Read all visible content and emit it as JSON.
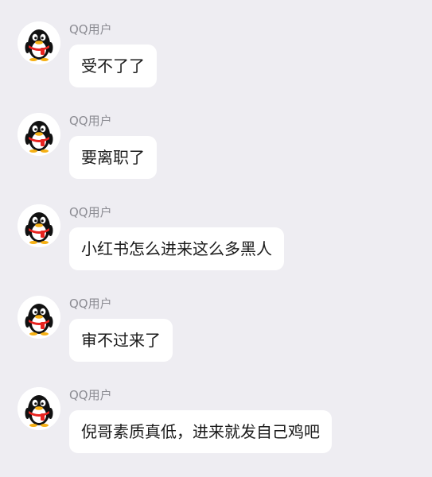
{
  "chat": {
    "messages": [
      {
        "sender": "QQ用户",
        "avatar_icon": "qq-penguin-icon",
        "text": "受不了了"
      },
      {
        "sender": "QQ用户",
        "avatar_icon": "qq-penguin-icon",
        "text": "要离职了"
      },
      {
        "sender": "QQ用户",
        "avatar_icon": "qq-penguin-icon",
        "text": "小红书怎么进来这么多黑人"
      },
      {
        "sender": "QQ用户",
        "avatar_icon": "qq-penguin-icon",
        "text": "审不过来了"
      },
      {
        "sender": "QQ用户",
        "avatar_icon": "qq-penguin-icon",
        "text": "倪哥素质真低，进来就发自己鸡吧"
      }
    ]
  },
  "colors": {
    "background": "#eeedf2",
    "bubble": "#ffffff",
    "sender_text": "#8c8c93",
    "message_text": "#1a1a1a",
    "penguin_scarf": "#e8231f",
    "penguin_beak": "#f5b014"
  }
}
